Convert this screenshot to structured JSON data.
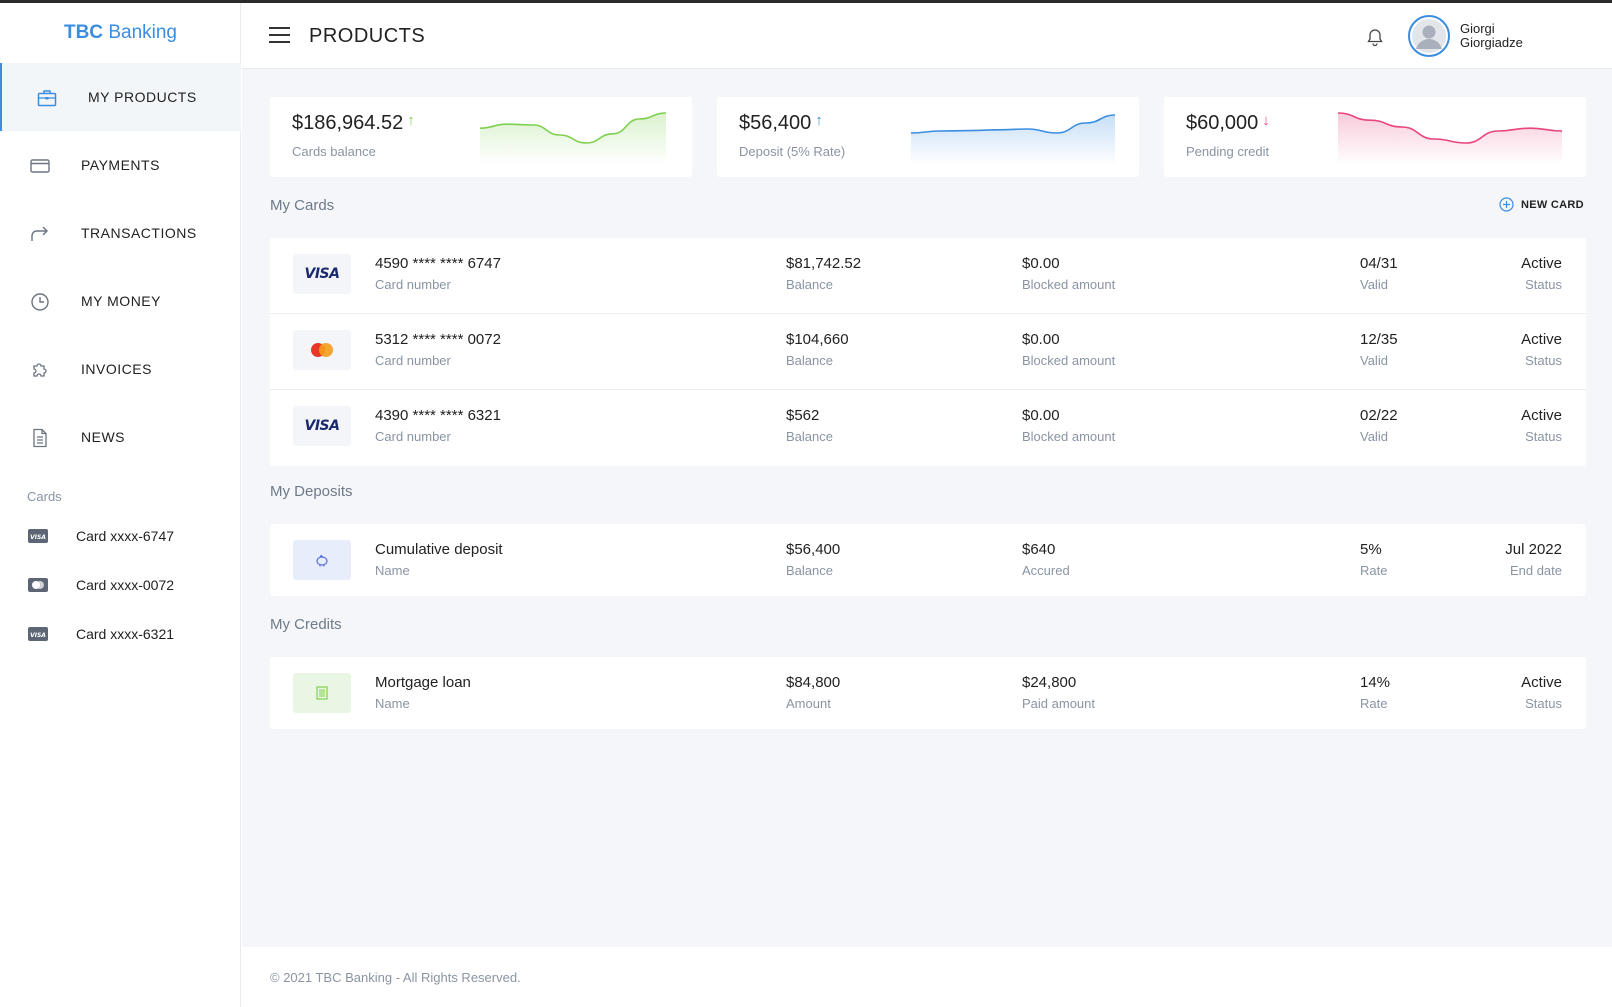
{
  "brand": {
    "name_bold": "TBC",
    "name_light": "Banking"
  },
  "sidebar": {
    "items": [
      {
        "label": "MY PRODUCTS",
        "icon": "briefcase-icon",
        "active": true
      },
      {
        "label": "PAYMENTS",
        "icon": "credit-card-icon"
      },
      {
        "label": "TRANSACTIONS",
        "icon": "share-arrow-icon"
      },
      {
        "label": "MY MONEY",
        "icon": "clock-icon"
      },
      {
        "label": "INVOICES",
        "icon": "puzzle-icon"
      },
      {
        "label": "NEWS",
        "icon": "document-icon"
      }
    ],
    "cards_heading": "Cards",
    "cards": [
      {
        "label": "Card xxxx-6747",
        "icon": "visa-card-icon"
      },
      {
        "label": "Card xxxx-0072",
        "icon": "mastercard-card-icon"
      },
      {
        "label": "Card xxxx-6321",
        "icon": "visa-card-icon"
      }
    ]
  },
  "header": {
    "title": "PRODUCTS",
    "user_first": "Giorgi",
    "user_last": "Giorgiadze"
  },
  "stats": [
    {
      "amount": "$186,964.52",
      "arrow": "↑",
      "label": "Cards balance",
      "color": "#7ed050",
      "trend": [
        0.62,
        0.72,
        0.7,
        0.45,
        0.25,
        0.48,
        0.85,
        1.0
      ]
    },
    {
      "amount": "$56,400",
      "arrow": "↑",
      "label": "Deposit (5% Rate)",
      "color": "#3a8de0",
      "trend": [
        0.5,
        0.55,
        0.56,
        0.58,
        0.6,
        0.5,
        0.75,
        0.95
      ]
    },
    {
      "amount": "$60,000",
      "arrow": "↓",
      "label": "Pending credit",
      "color": "#e9457a",
      "trend": [
        1.0,
        0.82,
        0.65,
        0.35,
        0.25,
        0.55,
        0.62,
        0.55
      ]
    }
  ],
  "my_cards": {
    "title": "My Cards",
    "new_card_label": "NEW CARD",
    "rows": [
      {
        "brand": "VISA",
        "number": "4590 **** **** 6747",
        "number_label": "Card number",
        "balance": "$81,742.52",
        "balance_label": "Balance",
        "blocked": "$0.00",
        "blocked_label": "Blocked amount",
        "valid": "04/31",
        "valid_label": "Valid",
        "status": "Active",
        "status_label": "Status"
      },
      {
        "brand": "mastercard",
        "number": "5312 **** **** 0072",
        "number_label": "Card number",
        "balance": "$104,660",
        "balance_label": "Balance",
        "blocked": "$0.00",
        "blocked_label": "Blocked amount",
        "valid": "12/35",
        "valid_label": "Valid",
        "status": "Active",
        "status_label": "Status"
      },
      {
        "brand": "VISA",
        "number": "4390 **** **** 6321",
        "number_label": "Card number",
        "balance": "$562",
        "balance_label": "Balance",
        "blocked": "$0.00",
        "blocked_label": "Blocked amount",
        "valid": "02/22",
        "valid_label": "Valid",
        "status": "Active",
        "status_label": "Status"
      }
    ]
  },
  "my_deposits": {
    "title": "My Deposits",
    "rows": [
      {
        "name": "Cumulative deposit",
        "name_label": "Name",
        "balance": "$56,400",
        "balance_label": "Balance",
        "accrued": "$640",
        "accrued_label": "Accured",
        "rate": "5%",
        "rate_label": "Rate",
        "end": "Jul 2022",
        "end_label": "End date"
      }
    ]
  },
  "my_credits": {
    "title": "My Credits",
    "rows": [
      {
        "name": "Mortgage loan",
        "name_label": "Name",
        "amount": "$84,800",
        "amount_label": "Amount",
        "paid": "$24,800",
        "paid_label": "Paid amount",
        "rate": "14%",
        "rate_label": "Rate",
        "status": "Active",
        "status_label": "Status"
      }
    ]
  },
  "footer": {
    "text": "© 2021 TBC Banking - All Rights Reserved."
  }
}
